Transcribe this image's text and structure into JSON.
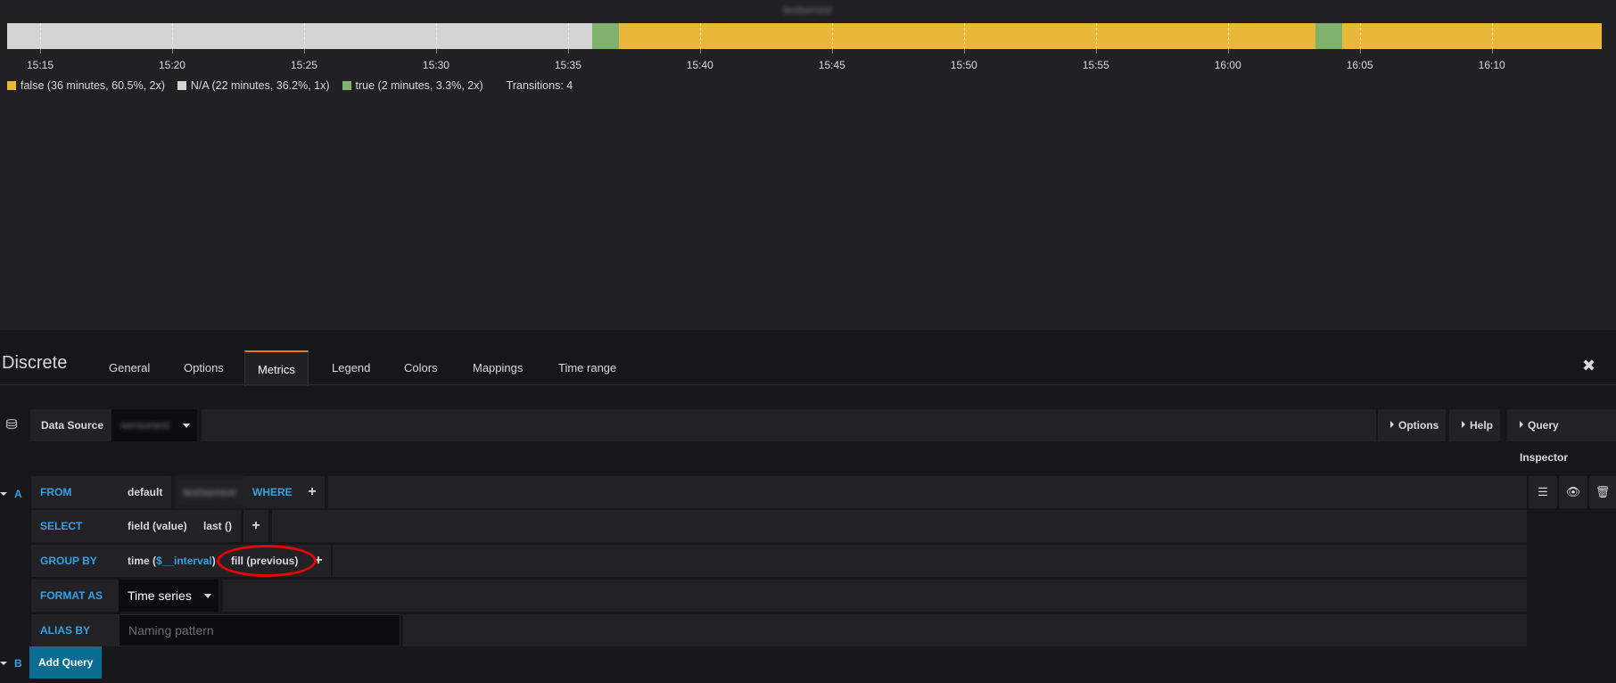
{
  "panel": {
    "title": "testsensor",
    "time_axis": {
      "ticks": [
        "15:15",
        "15:20",
        "15:25",
        "15:30",
        "15:35",
        "15:40",
        "15:45",
        "15:50",
        "15:55",
        "16:00",
        "16:05",
        "16:10"
      ]
    },
    "legend": {
      "items": [
        {
          "label": "false (36 minutes, 60.5%, 2x)",
          "color": "#eab839"
        },
        {
          "label": "N/A (22 minutes, 36.2%, 1x)",
          "color": "#d4d4d4"
        },
        {
          "label": "true (2 minutes, 3.3%, 2x)",
          "color": "#7eb26d"
        }
      ],
      "transitions": "Transitions: 4"
    }
  },
  "chart_data": {
    "type": "discrete-timeline",
    "x_range": [
      "15:13:45",
      "16:14:10"
    ],
    "segments": [
      {
        "state": "N/A",
        "start": "15:13:45",
        "end": "15:35:55",
        "color": "#d4d4d4"
      },
      {
        "state": "true",
        "start": "15:35:55",
        "end": "15:36:55",
        "color": "#7eb26d"
      },
      {
        "state": "false",
        "start": "15:36:55",
        "end": "16:03:20",
        "color": "#eab839"
      },
      {
        "state": "true",
        "start": "16:03:20",
        "end": "16:04:20",
        "color": "#7eb26d"
      },
      {
        "state": "false",
        "start": "16:04:20",
        "end": "16:14:10",
        "color": "#eab839"
      }
    ]
  },
  "editor": {
    "title": "Discrete",
    "tabs": [
      {
        "label": "General",
        "active": false
      },
      {
        "label": "Options",
        "active": false
      },
      {
        "label": "Metrics",
        "active": true
      },
      {
        "label": "Legend",
        "active": false
      },
      {
        "label": "Colors",
        "active": false
      },
      {
        "label": "Mappings",
        "active": false
      },
      {
        "label": "Time range",
        "active": false
      }
    ],
    "close_icon": "close-icon"
  },
  "datasource": {
    "label": "Data Source",
    "value": "sensortest",
    "options_label": "Options",
    "help_label": "Help",
    "inspector_label": "Query Inspector"
  },
  "query_a": {
    "letter": "A",
    "from_label": "FROM",
    "from_policy": "default",
    "from_measurement": "testsensor",
    "where_label": "WHERE",
    "select_label": "SELECT",
    "select_field": "field (value)",
    "select_fn": "last ()",
    "group_label": "GROUP BY",
    "group_time_prefix": "time (",
    "group_time_var": "$__interval",
    "group_time_suffix": ")",
    "group_fill": "fill (previous)",
    "format_label": "FORMAT AS",
    "format_value": "Time series",
    "alias_label": "ALIAS BY",
    "alias_placeholder": "Naming pattern"
  },
  "query_b": {
    "letter": "B",
    "add_label": "Add Query"
  }
}
